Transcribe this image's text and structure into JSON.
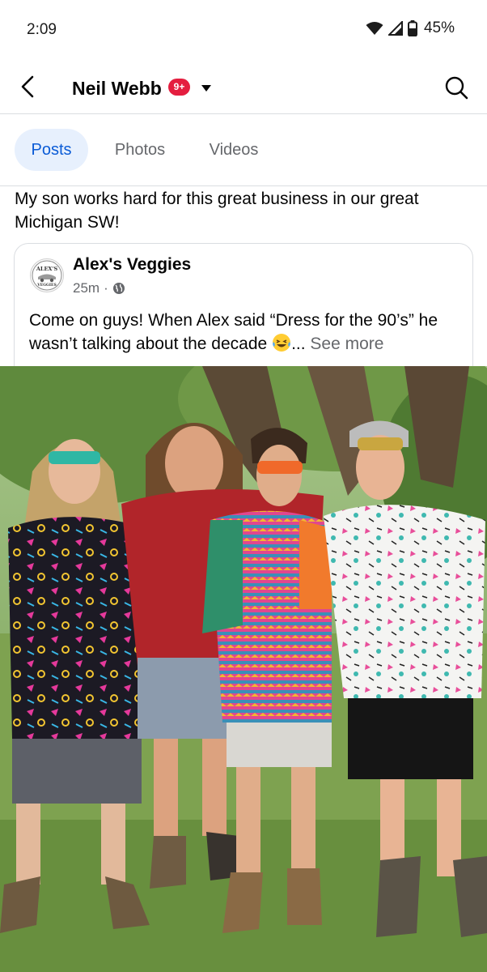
{
  "status_bar": {
    "time": "2:09",
    "battery": "45%",
    "icons": [
      "wifi-icon",
      "signal-icon",
      "battery-icon"
    ]
  },
  "header": {
    "title": "Neil Webb",
    "notification_badge": "9+",
    "icons": [
      "back-arrow-icon",
      "caret-down-icon",
      "search-icon"
    ]
  },
  "tabs": [
    {
      "label": "Posts",
      "active": true
    },
    {
      "label": "Photos",
      "active": false
    },
    {
      "label": "Videos",
      "active": false
    }
  ],
  "post": {
    "text": "My son works hard for this great business in our great Michigan SW!",
    "shared": {
      "page_name": "Alex's Veggies",
      "time_ago": "25m",
      "separator": "·",
      "audience_icon": "globe-icon",
      "text": "Come on guys! When Alex said “Dress for the 90’s” he wasn’t talking about the decade",
      "ellipsis": "...",
      "see_more": "See more",
      "avatar_text_line1": "ALEX'S",
      "avatar_text_line2": "VEGGIES"
    },
    "photo_icon": "group-photo-image"
  },
  "colors": {
    "accent": "#0a5bd6",
    "active_tab_bg": "#e7f0fd",
    "badge": "#e41e3f",
    "secondary_text": "#65676b"
  }
}
